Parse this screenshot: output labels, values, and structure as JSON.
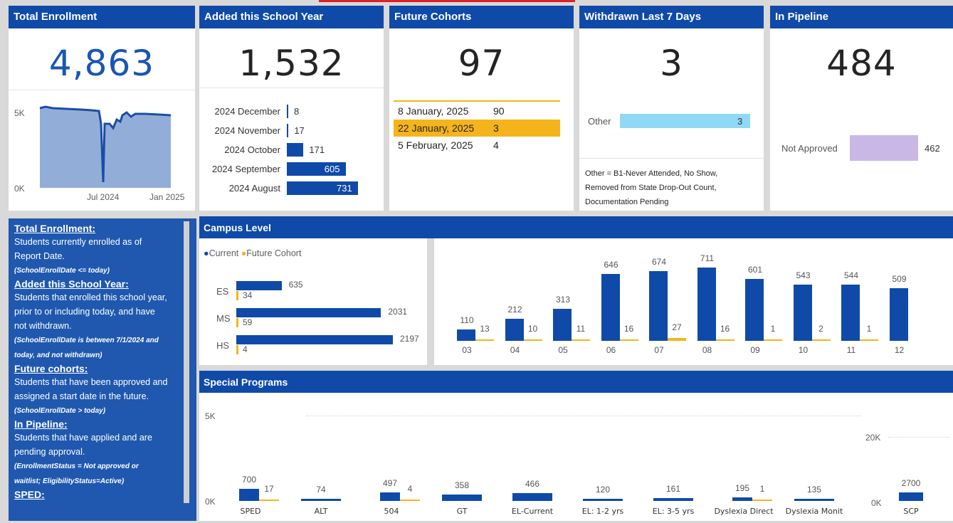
{
  "cards": {
    "total_enrollment": {
      "title": "Total Enrollment",
      "value": "4,863",
      "y_top": "5K",
      "y_bottom": "0K",
      "x_ticks": [
        "Jul 2024",
        "Jan 2025"
      ]
    },
    "added": {
      "title": "Added this School Year",
      "value": "1,532",
      "rows": [
        {
          "label": "2024 December",
          "value": 8
        },
        {
          "label": "2024 November",
          "value": 17
        },
        {
          "label": "2024 October",
          "value": 171
        },
        {
          "label": "2024 September",
          "value": 605
        },
        {
          "label": "2024 August",
          "value": 731
        }
      ]
    },
    "future": {
      "title": "Future Cohorts",
      "value": "97",
      "rows": [
        {
          "date": "8 January, 2025",
          "count": "90",
          "highlighted": false
        },
        {
          "date": "22 January, 2025",
          "count": "3",
          "highlighted": true
        },
        {
          "date": "5 February, 2025",
          "count": "4",
          "highlighted": false
        }
      ]
    },
    "withdrawn": {
      "title": "Withdrawn Last 7 Days",
      "value": "3",
      "bar_label": "Other",
      "bar_value": "3",
      "note": [
        "Other = B1-Never Attended, No Show,",
        "Removed from State Drop-Out Count,",
        "Documentation Pending"
      ]
    },
    "pipeline": {
      "title": "In Pipeline",
      "value": "484",
      "bar_label": "Not Approved",
      "bar_value": "462"
    }
  },
  "definitions": [
    {
      "title": "Total Enrollment:",
      "desc": [
        "Students currently enrolled as of",
        "Report Date."
      ],
      "formula": [
        "(SchoolEnrollDate <= today)"
      ]
    },
    {
      "title": "Added this School Year:",
      "desc": [
        "Students that enrolled this school year,",
        "prior to or including today, and have",
        "not withdrawn."
      ],
      "formula": [
        "(SchoolEnrollDate is between 7/1/2024 and",
        "today, and not withdrawn)"
      ]
    },
    {
      "title": "Future cohorts:",
      "desc": [
        "Students that have been approved and",
        "assigned a start date in the future."
      ],
      "formula": [
        "(SchoolEnrollDate > today)"
      ]
    },
    {
      "title": "In Pipeline:",
      "desc": [
        "Students that have applied and are",
        "pending approval."
      ],
      "formula": [
        "(EnrollmentStatus = Not approved or",
        "waitlist; EligibilityStatus=Active)"
      ]
    },
    {
      "title": "SPED:",
      "desc": [],
      "formula": []
    }
  ],
  "campus": {
    "title": "Campus Level",
    "legend": [
      {
        "name": "Current",
        "color": "#0f4aa8"
      },
      {
        "name": "Future Cohort",
        "color": "#f5b41c"
      }
    ],
    "levels": [
      {
        "label": "ES",
        "current": 635,
        "future": 34
      },
      {
        "label": "MS",
        "current": 2031,
        "future": 59
      },
      {
        "label": "HS",
        "current": 2197,
        "future": 4
      }
    ],
    "grades": [
      {
        "label": "03",
        "current": 110,
        "future": 13
      },
      {
        "label": "04",
        "current": 212,
        "future": 10
      },
      {
        "label": "05",
        "current": 313,
        "future": 11
      },
      {
        "label": "06",
        "current": 646,
        "future": 16
      },
      {
        "label": "07",
        "current": 674,
        "future": 27
      },
      {
        "label": "08",
        "current": 711,
        "future": 16
      },
      {
        "label": "09",
        "current": 601,
        "future": 1
      },
      {
        "label": "10",
        "current": 543,
        "future": 2
      },
      {
        "label": "11",
        "current": 544,
        "future": 1
      },
      {
        "label": "12",
        "current": 509,
        "future": null
      }
    ]
  },
  "special": {
    "title": "Special Programs",
    "y_left_top": "5K",
    "y_left_bottom": "0K",
    "y_right_top": "20K",
    "y_right_bottom": "0K",
    "programs": [
      {
        "label": "SPED",
        "current": 700,
        "future": 17
      },
      {
        "label": "ALT",
        "current": 74,
        "future": null
      },
      {
        "label": "504",
        "current": 497,
        "future": 4
      },
      {
        "label": "GT",
        "current": 358,
        "future": null
      },
      {
        "label": "EL-Current",
        "current": 466,
        "future": null
      },
      {
        "label": "EL: 1-2 yrs",
        "current": 120,
        "future": null
      },
      {
        "label": "EL: 3-5 yrs",
        "current": 161,
        "future": null
      },
      {
        "label": "Dyslexia Direct",
        "current": 195,
        "future": 1
      },
      {
        "label": "Dyslexia Monit",
        "current": 135,
        "future": null
      },
      {
        "label": "SCP",
        "current": 2700,
        "future": null
      }
    ]
  },
  "colors": {
    "header": "#0f4aa8",
    "bar": "#0f4aa8",
    "future": "#f5b41c",
    "other_bar": "#8fd9f7",
    "pending_bar": "#c9b8e6",
    "area": "#93add9",
    "top_accent": "#d9222a"
  }
}
